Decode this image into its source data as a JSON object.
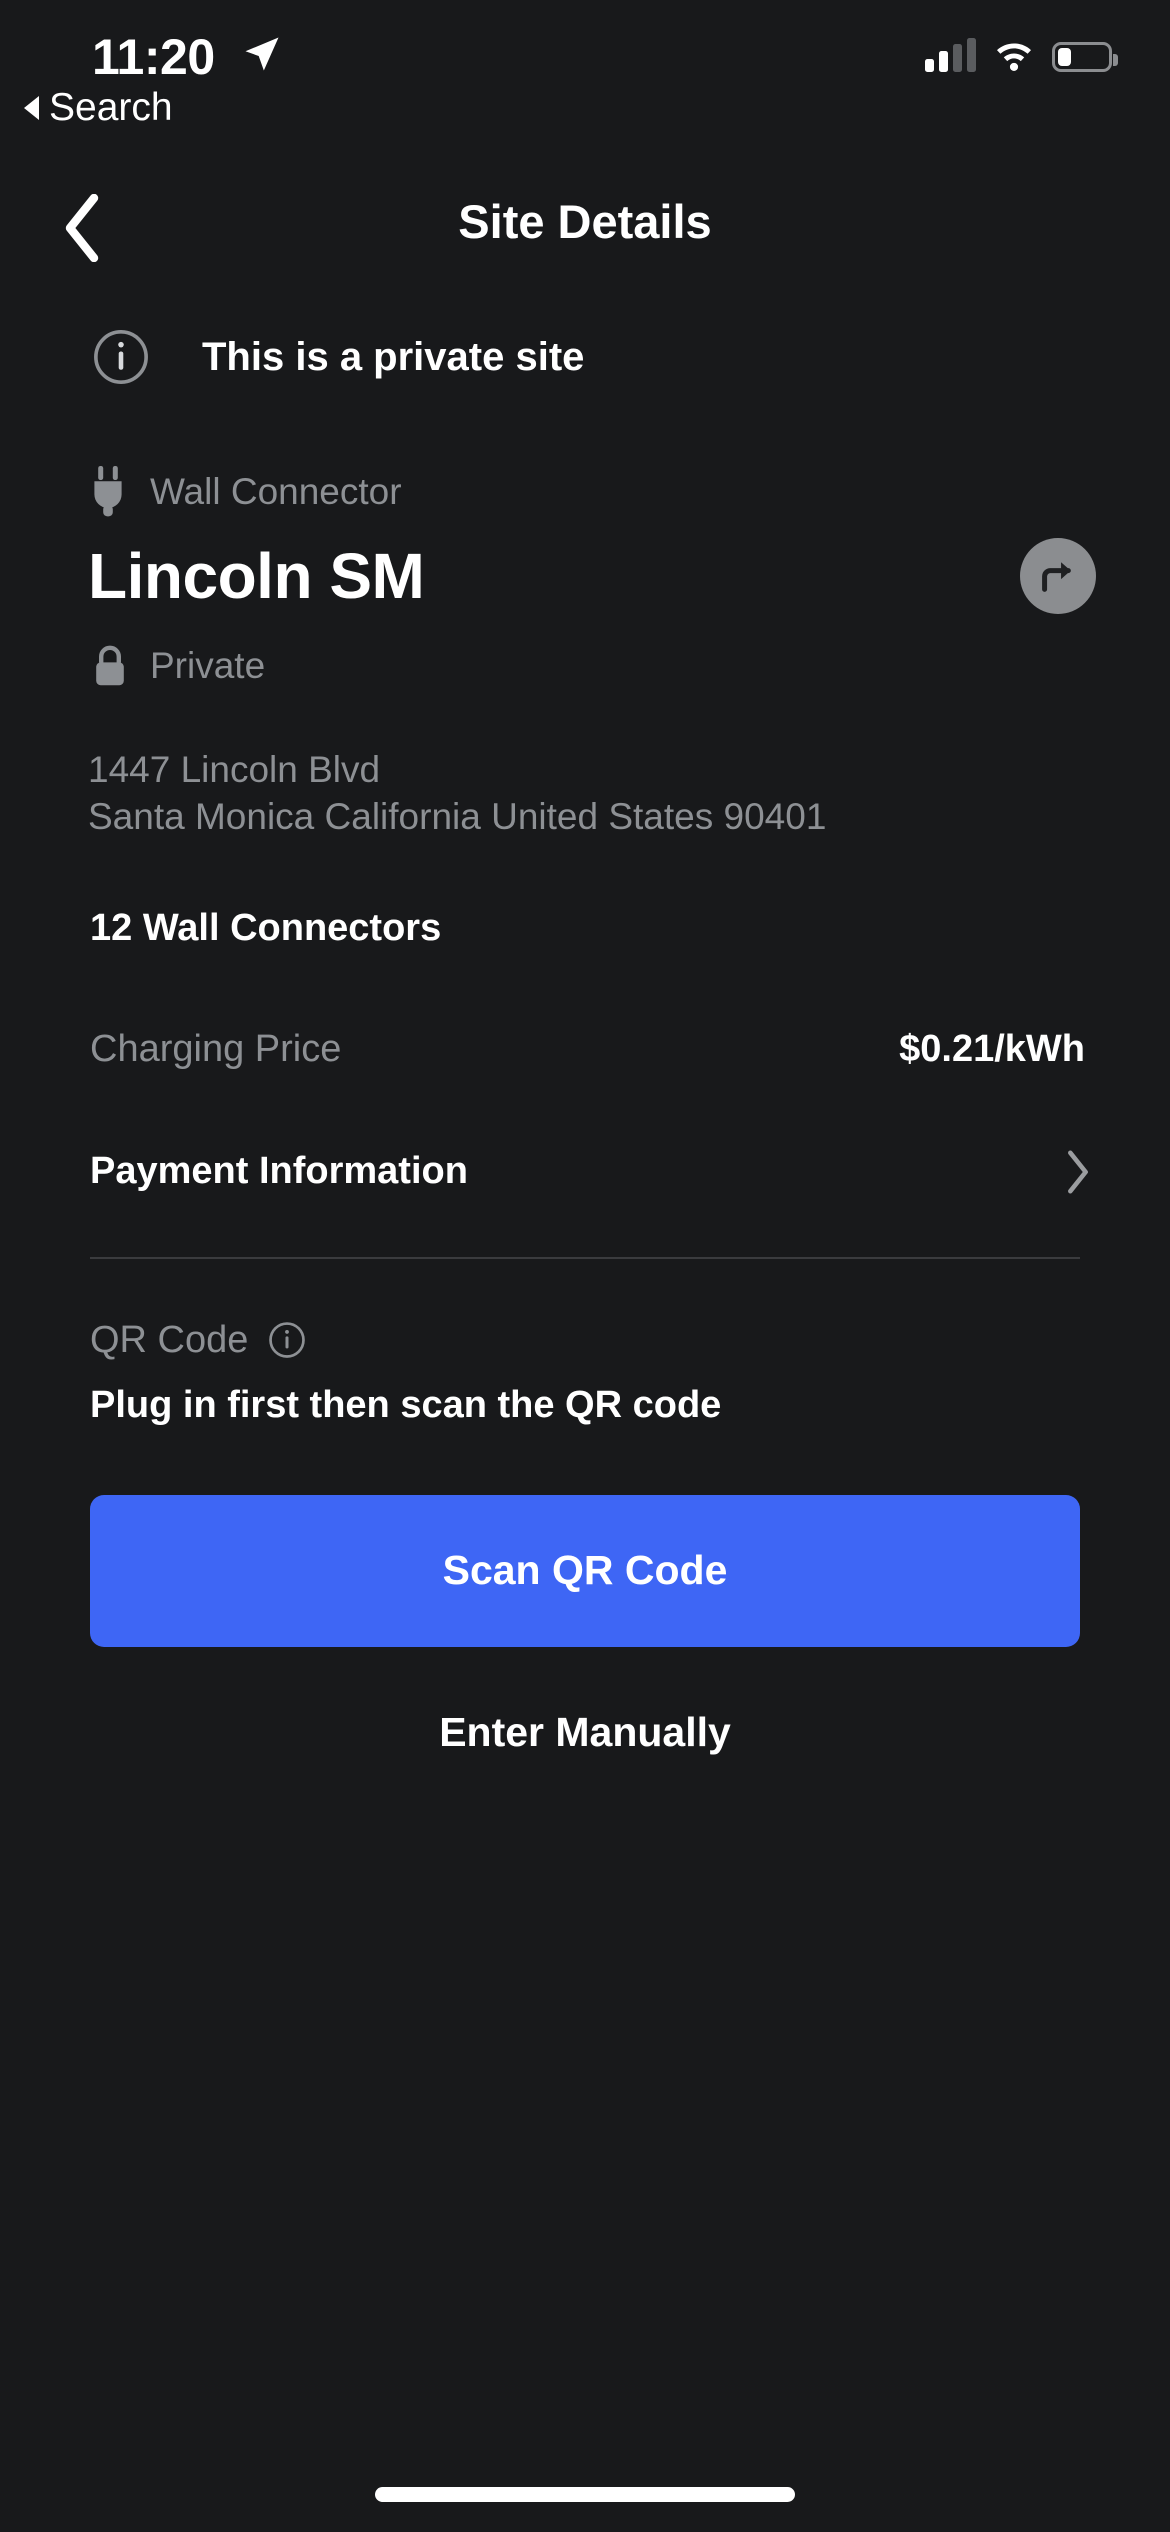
{
  "status_bar": {
    "time": "11:20",
    "location_icon": "location-arrow-icon",
    "back_app_label": "Search",
    "cellular_icon": "cellular-signal-icon",
    "wifi_icon": "wifi-icon",
    "battery_icon": "battery-low-icon"
  },
  "nav": {
    "back_icon": "chevron-left-icon",
    "title": "Site Details"
  },
  "notice": {
    "icon": "info-circle-icon",
    "text": "This is a private site"
  },
  "site": {
    "type_icon": "plug-icon",
    "type_label": "Wall Connector",
    "name": "Lincoln SM",
    "share_icon": "directions-arrow-icon",
    "access_icon": "lock-icon",
    "access_label": "Private",
    "address_line1": "1447 Lincoln Blvd",
    "address_line2": "Santa Monica California United States 90401",
    "connectors_label": "12 Wall Connectors"
  },
  "details": {
    "price_label": "Charging Price",
    "price_value": "$0.21/kWh",
    "payment_label": "Payment Information",
    "payment_chevron_icon": "chevron-right-icon"
  },
  "qr": {
    "section_label": "QR Code",
    "section_info_icon": "info-circle-icon",
    "instruction": "Plug in first then scan the QR code",
    "scan_button_label": "Scan QR Code",
    "manual_link_label": "Enter Manually"
  },
  "colors": {
    "background": "#18191b",
    "accent_blue": "#3e66f5",
    "muted_text": "#8d9094",
    "divider": "#3a3b3e"
  }
}
